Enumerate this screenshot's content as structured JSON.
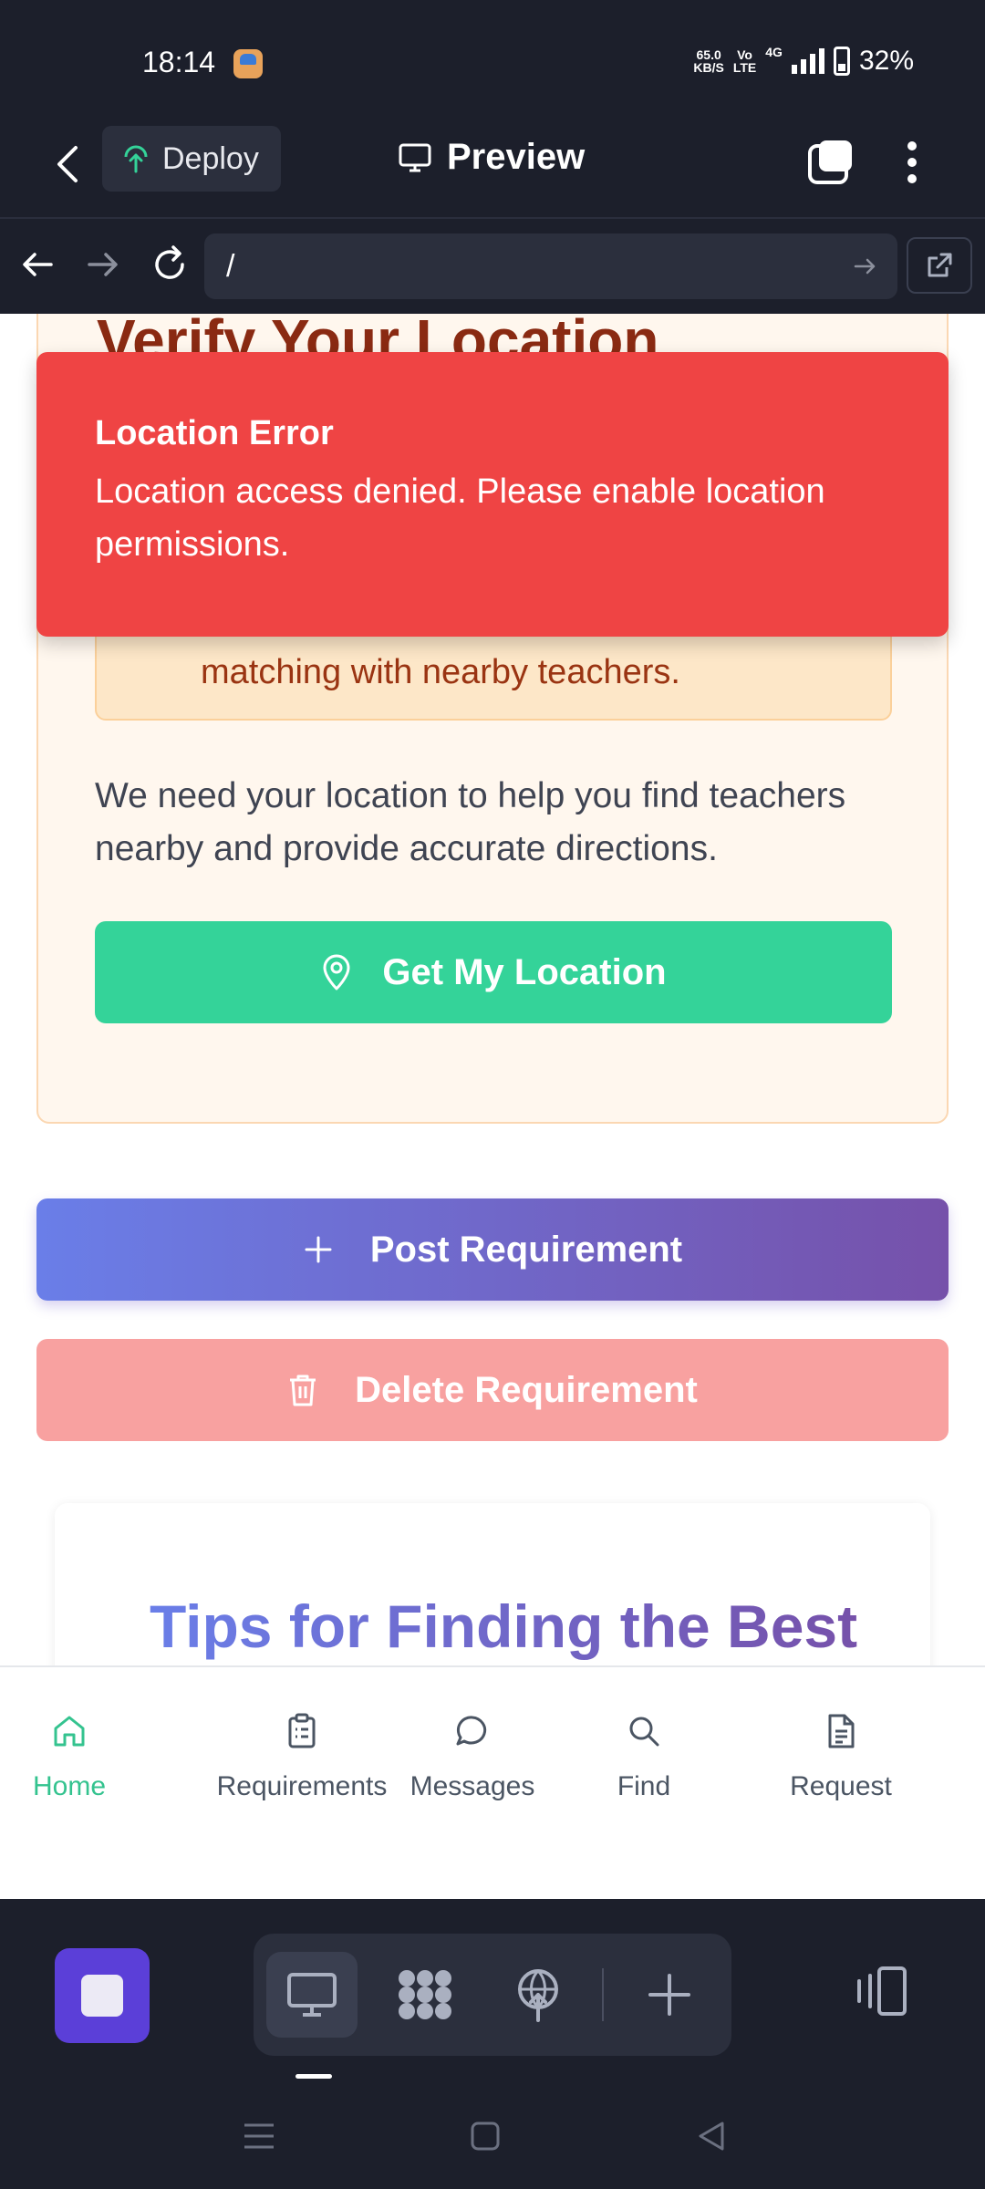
{
  "status_bar": {
    "time": "18:14",
    "net_speed_value": "65.0",
    "net_speed_unit": "KB/S",
    "volte_top": "Vo",
    "volte_bottom": "LTE",
    "network": "4G",
    "battery": "32%"
  },
  "header": {
    "deploy_label": "Deploy",
    "title": "Preview"
  },
  "browser": {
    "url": "/"
  },
  "verify_card": {
    "title": "Verify Your Location",
    "notice": "accurate distance calculations and better matching with nearby teachers.",
    "description": "We need your location to help you find teachers nearby and provide accurate directions.",
    "button_label": "Get My Location"
  },
  "actions": {
    "post_label": "Post Requirement",
    "delete_label": "Delete Requirement"
  },
  "tips": {
    "title": "Tips for Finding the Best"
  },
  "toast": {
    "title": "Location Error",
    "message": "Location access denied. Please enable location permissions."
  },
  "bottom_nav": {
    "items": [
      {
        "label": "Home",
        "icon": "home-icon",
        "active": true
      },
      {
        "label": "Requirements",
        "icon": "clipboard-icon",
        "active": false
      },
      {
        "label": "Messages",
        "icon": "chat-icon",
        "active": false
      },
      {
        "label": "Find",
        "icon": "search-icon",
        "active": false
      },
      {
        "label": "Request",
        "icon": "document-icon",
        "active": false
      }
    ]
  },
  "colors": {
    "accent_green": "#34d399",
    "error_red": "#ef4444",
    "gradient_start": "#6a7ee8",
    "gradient_end": "#7651aa",
    "stop_purple": "#5b3fd8"
  }
}
